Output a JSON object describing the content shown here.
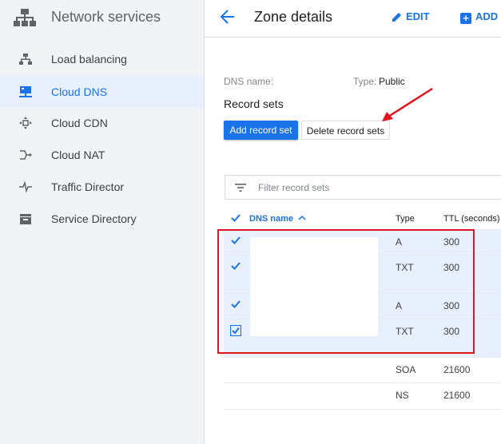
{
  "sidebar": {
    "title": "Network services",
    "items": [
      {
        "label": "Load balancing",
        "icon": "load-balancing-icon",
        "active": false
      },
      {
        "label": "Cloud DNS",
        "icon": "cloud-dns-icon",
        "active": true
      },
      {
        "label": "Cloud CDN",
        "icon": "cloud-cdn-icon",
        "active": false
      },
      {
        "label": "Cloud NAT",
        "icon": "cloud-nat-icon",
        "active": false
      },
      {
        "label": "Traffic Director",
        "icon": "traffic-director-icon",
        "active": false
      },
      {
        "label": "Service Directory",
        "icon": "service-directory-icon",
        "active": false
      }
    ]
  },
  "header": {
    "title": "Zone details",
    "edit_label": "EDIT",
    "add_label": "ADD I"
  },
  "zone": {
    "dns_name_label": "DNS name:",
    "type_label": "Type:",
    "type_value": "Public"
  },
  "record_sets": {
    "title": "Record sets",
    "add_button": "Add record set",
    "delete_button": "Delete record sets",
    "filter_placeholder": "Filter record sets",
    "columns": {
      "name": "DNS name",
      "type": "Type",
      "ttl": "TTL (seconds)"
    },
    "rows": [
      {
        "type": "A",
        "ttl": "300",
        "checked": true
      },
      {
        "type": "TXT",
        "ttl": "300",
        "checked": true
      },
      {
        "type": "A",
        "ttl": "300",
        "checked": true
      },
      {
        "type": "TXT",
        "ttl": "300",
        "checked": true
      },
      {
        "type": "SOA",
        "ttl": "21600",
        "checked": false
      },
      {
        "type": "NS",
        "ttl": "21600",
        "checked": false
      }
    ]
  },
  "colors": {
    "accent": "#1a73e8",
    "highlight": "#e0141e",
    "selected_row": "#e8f0fe",
    "sidebar_bg": "#f1f3f4"
  }
}
